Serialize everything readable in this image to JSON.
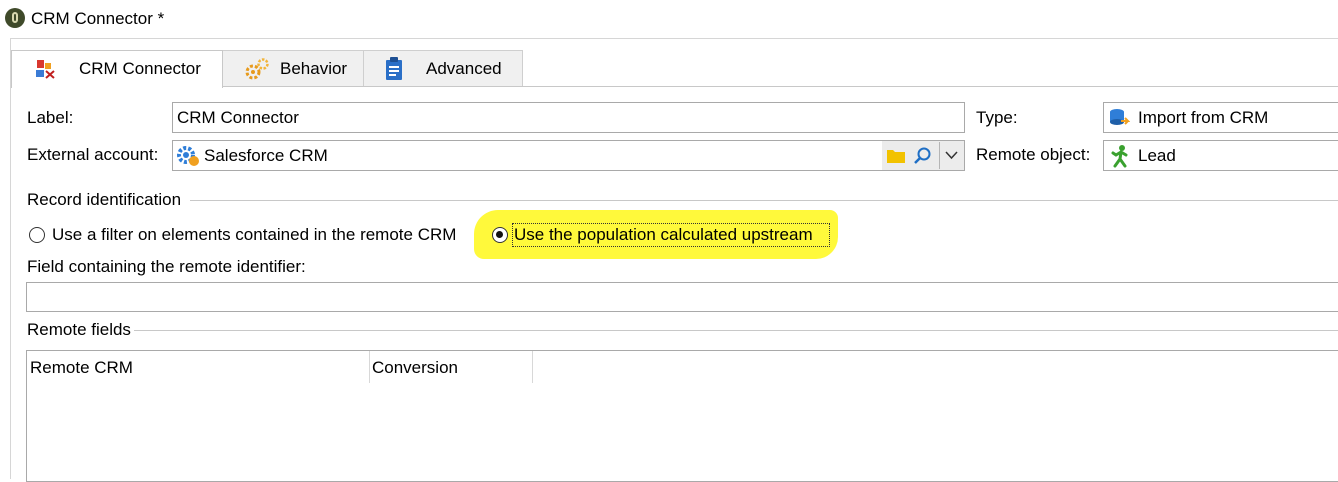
{
  "window": {
    "title": "CRM Connector *"
  },
  "tabs": [
    {
      "label": "CRM Connector",
      "icon": "crm-connector-icon",
      "active": true
    },
    {
      "label": "Behavior",
      "icon": "gears-icon",
      "active": false
    },
    {
      "label": "Advanced",
      "icon": "clipboard-icon",
      "active": false
    }
  ],
  "form": {
    "label_caption": "Label:",
    "label_value": "CRM Connector",
    "type_caption": "Type:",
    "type_value": "Import from CRM",
    "external_account_caption": "External account:",
    "external_account_value": "Salesforce CRM",
    "remote_object_caption": "Remote object:",
    "remote_object_value": "Lead"
  },
  "record_identification": {
    "title": "Record identification",
    "option_filter": "Use a filter on elements contained in the remote CRM",
    "option_population": "Use the population calculated upstream",
    "selected": "population",
    "field_caption": "Field containing the remote identifier:",
    "field_value": ""
  },
  "remote_fields": {
    "title": "Remote fields",
    "columns": [
      "Remote CRM",
      "Conversion"
    ]
  },
  "colors": {
    "highlight": "#fff93b",
    "folder": "#f2c200",
    "search": "#1f6fc5"
  }
}
